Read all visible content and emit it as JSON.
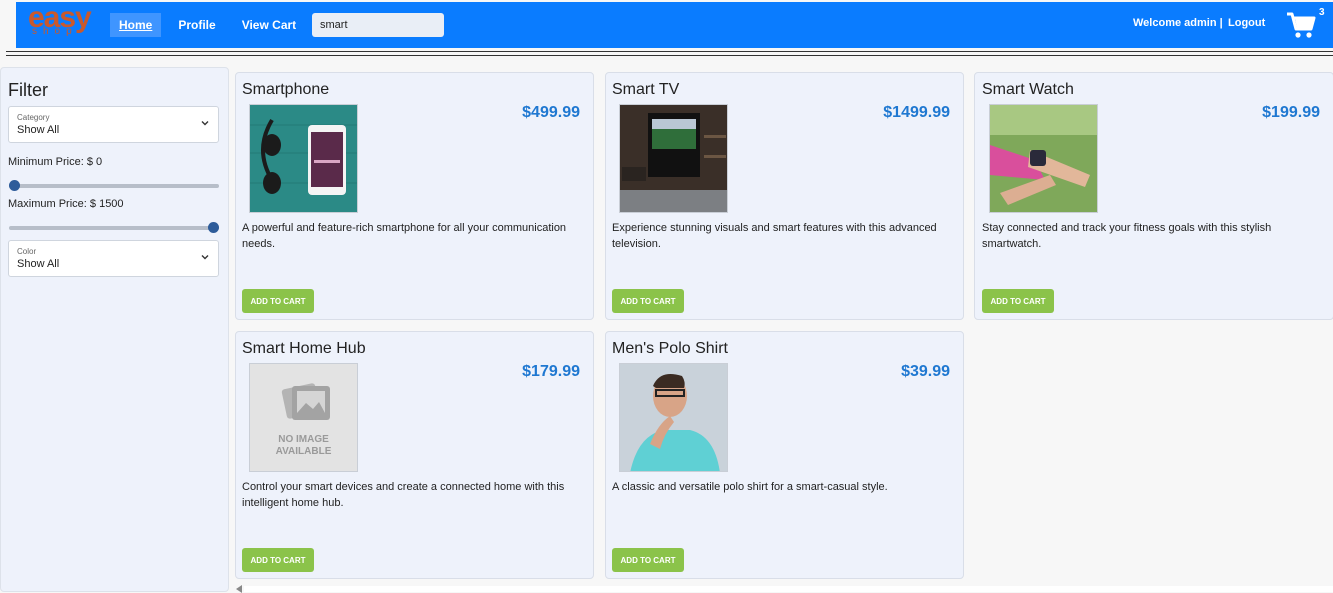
{
  "header": {
    "logo_big": "easy",
    "logo_small": "shop",
    "nav": [
      {
        "label": "Home"
      },
      {
        "label": "Profile"
      },
      {
        "label": "View Cart"
      }
    ],
    "search_value": "smart",
    "welcome": "Welcome admin |",
    "logout": "Logout",
    "cart_count": "3"
  },
  "sidebar": {
    "title": "Filter",
    "category": {
      "label": "Category",
      "value": "Show All"
    },
    "min_price_label": "Minimum Price: $ 0",
    "max_price_label": "Maximum Price: $ 1500",
    "min_price_fraction": 0,
    "max_price_fraction": 1,
    "color": {
      "label": "Color",
      "value": "Show All"
    }
  },
  "products": [
    {
      "name": "Smartphone",
      "price": "$499.99",
      "desc": "A powerful and feature-rich smartphone for all your communication needs.",
      "button": "ADD TO CART",
      "image": "smartphone-headphones"
    },
    {
      "name": "Smart TV",
      "price": "$1499.99",
      "desc": "Experience stunning visuals and smart features with this advanced television.",
      "button": "ADD TO CART",
      "image": "tv-living-room"
    },
    {
      "name": "Smart Watch",
      "price": "$199.99",
      "desc": "Stay connected and track your fitness goals with this stylish smartwatch.",
      "button": "ADD TO CART",
      "image": "smartwatch-wrist"
    },
    {
      "name": "Smart Home Hub",
      "price": "$179.99",
      "desc": "Control your smart devices and create a connected home with this intelligent home hub.",
      "button": "ADD TO CART",
      "image": "no-image",
      "image_text_1": "NO IMAGE",
      "image_text_2": "AVAILABLE"
    },
    {
      "name": "Men's Polo Shirt",
      "price": "$39.99",
      "desc": "A classic and versatile polo shirt for a smart-casual style.",
      "button": "ADD TO CART",
      "image": "man-polo"
    }
  ],
  "colors": {
    "header": "#0a7cff",
    "price": "#1f78d1",
    "button": "#8bc34a",
    "logo": "#c9592c"
  }
}
